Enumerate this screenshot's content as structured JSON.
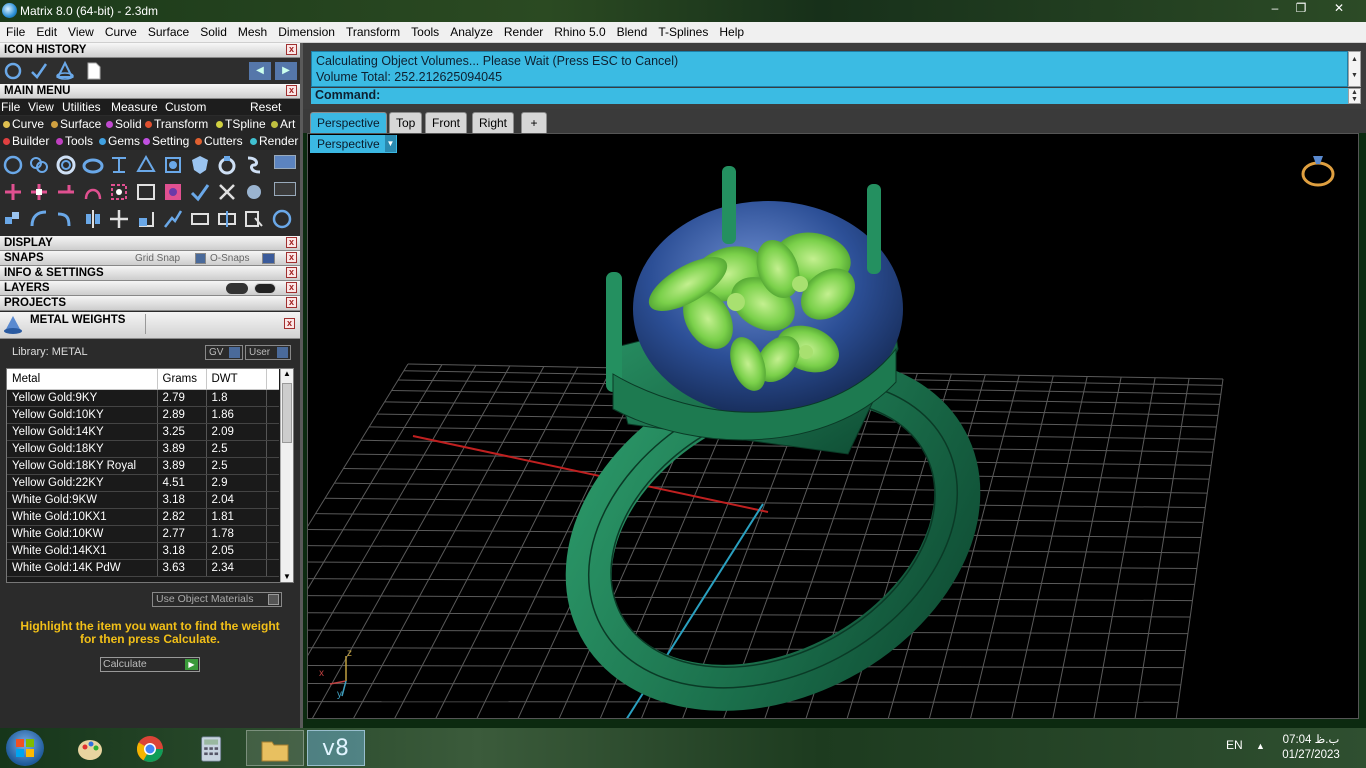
{
  "window": {
    "title": "Matrix 8.0 (64-bit) - 2.3dm",
    "btn_min": "–",
    "btn_max": "❐",
    "btn_close": "✕"
  },
  "menubar": [
    "File",
    "Edit",
    "View",
    "Curve",
    "Surface",
    "Solid",
    "Mesh",
    "Dimension",
    "Transform",
    "Tools",
    "Analyze",
    "Render",
    "Rhino 5.0",
    "Blend",
    "T-Splines",
    "Help"
  ],
  "left_panel": {
    "icon_history": {
      "title": "ICON HISTORY",
      "close": "x",
      "back": "◀",
      "forward": "▶"
    },
    "main_menu": {
      "title": "MAIN MENU",
      "close": "x",
      "menu": [
        "File",
        "View",
        "Utilities",
        "Measure",
        "Custom"
      ],
      "reset": "Reset",
      "row1": [
        "Curve",
        "Surface",
        "Solid",
        "Transform",
        "TSpline",
        "Art"
      ],
      "row2": [
        "Builder",
        "Tools",
        "Gems",
        "Setting",
        "Cutters",
        "Render"
      ]
    },
    "sections": {
      "display": "DISPLAY",
      "snaps": "SNAPS",
      "grid_snap": "Grid Snap",
      "osnaps": "O-Snaps",
      "info": "INFO & SETTINGS",
      "layers": "LAYERS",
      "projects": "PROJECTS",
      "close": "x"
    },
    "metal_weights": {
      "title": "METAL WEIGHTS",
      "close": "x",
      "library_label": "Library: METAL",
      "gv_btn": "GV",
      "user_btn": "User",
      "columns": [
        "Metal",
        "Grams",
        "DWT"
      ],
      "rows": [
        [
          "Yellow Gold:9KY",
          "2.79",
          "1.8"
        ],
        [
          "Yellow Gold:10KY",
          "2.89",
          "1.86"
        ],
        [
          "Yellow Gold:14KY",
          "3.25",
          "2.09"
        ],
        [
          "Yellow Gold:18KY",
          "3.89",
          "2.5"
        ],
        [
          "Yellow Gold:18KY Royal",
          "3.89",
          "2.5"
        ],
        [
          "Yellow Gold:22KY",
          "4.51",
          "2.9"
        ],
        [
          "White Gold:9KW",
          "3.18",
          "2.04"
        ],
        [
          "White Gold:10KX1",
          "2.82",
          "1.81"
        ],
        [
          "White Gold:10KW",
          "2.77",
          "1.78"
        ],
        [
          "White Gold:14KX1",
          "3.18",
          "2.05"
        ],
        [
          "White Gold:14K PdW",
          "3.63",
          "2.34"
        ]
      ],
      "use_object_materials": "Use Object Materials",
      "hint": "Highlight the item you want to find the weight for then press Calculate.",
      "calculate": "Calculate"
    }
  },
  "command": {
    "line1": "Calculating Object Volumes... Please Wait (Press ESC to Cancel)",
    "line2": "Volume Total: 252.212625094045",
    "prompt": "Command:"
  },
  "viewport": {
    "tabs": [
      "Perspective",
      "Top",
      "Front",
      "Right"
    ],
    "add_tab": "+",
    "active_view": "Perspective",
    "axis_labels": {
      "z": "z",
      "x": "x",
      "y": "y"
    }
  },
  "taskbar": {
    "items": [
      "start",
      "paint",
      "chrome",
      "calculator",
      "explorer",
      "matrix"
    ],
    "lang": "EN",
    "tray_arrow": "▲",
    "time": "07:04 ب.ظ",
    "date": "01/27/2023"
  },
  "colors": {
    "accent": "#3bb8e3",
    "ring": "#1f7a55",
    "stone": "#2c4f96",
    "floral": "#7ad04a"
  }
}
